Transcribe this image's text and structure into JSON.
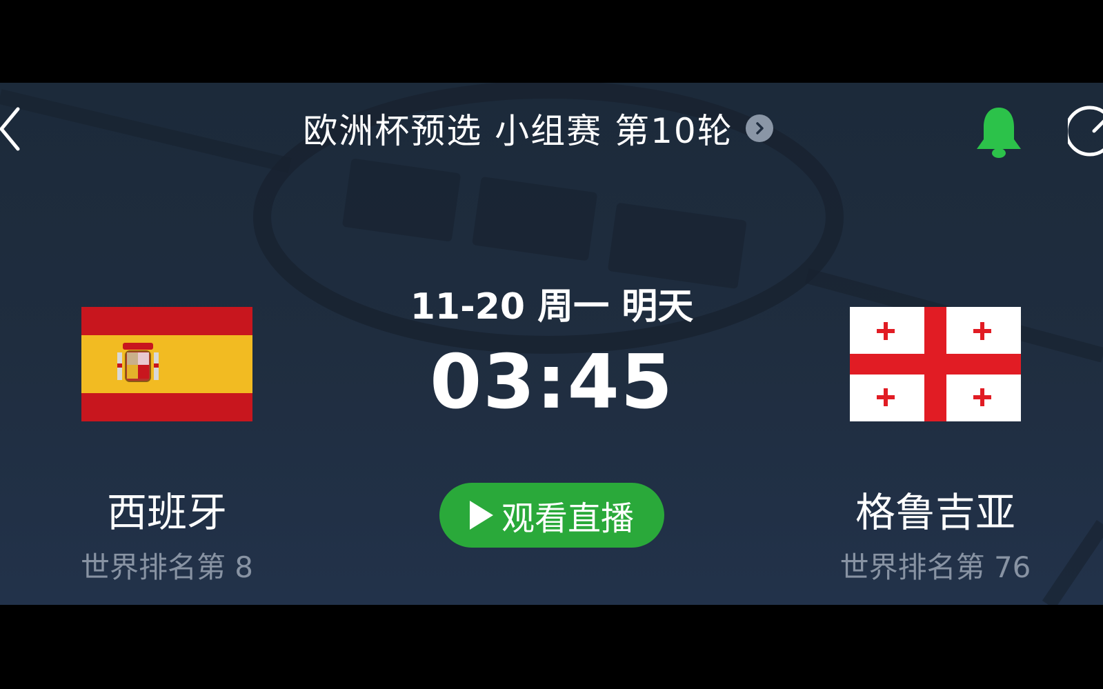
{
  "header": {
    "title": "欧洲杯预选 小组赛 第10轮",
    "back_icon": "chevron-left-icon",
    "title_chevron_icon": "chevron-right-icon",
    "bell_icon": "bell-icon",
    "refresh_icon": "refresh-icon"
  },
  "match": {
    "date_text": "11-20 周一 明天",
    "kickoff_time": "03:45",
    "watch_label": "观看直播",
    "watch_icon": "play-icon"
  },
  "home": {
    "name": "西班牙",
    "rank": "世界排名第 8",
    "flag_icon": "spain-flag"
  },
  "away": {
    "name": "格鲁吉亚",
    "rank": "世界排名第 76",
    "flag_icon": "georgia-flag"
  },
  "colors": {
    "background": "#1f2d3f",
    "accent_green": "#2aa93a",
    "bell_green": "#2cc24a",
    "muted_text": "#8893a3",
    "spain_red": "#c8161e",
    "spain_yellow": "#f2bb22",
    "georgia_red": "#e11c24"
  }
}
